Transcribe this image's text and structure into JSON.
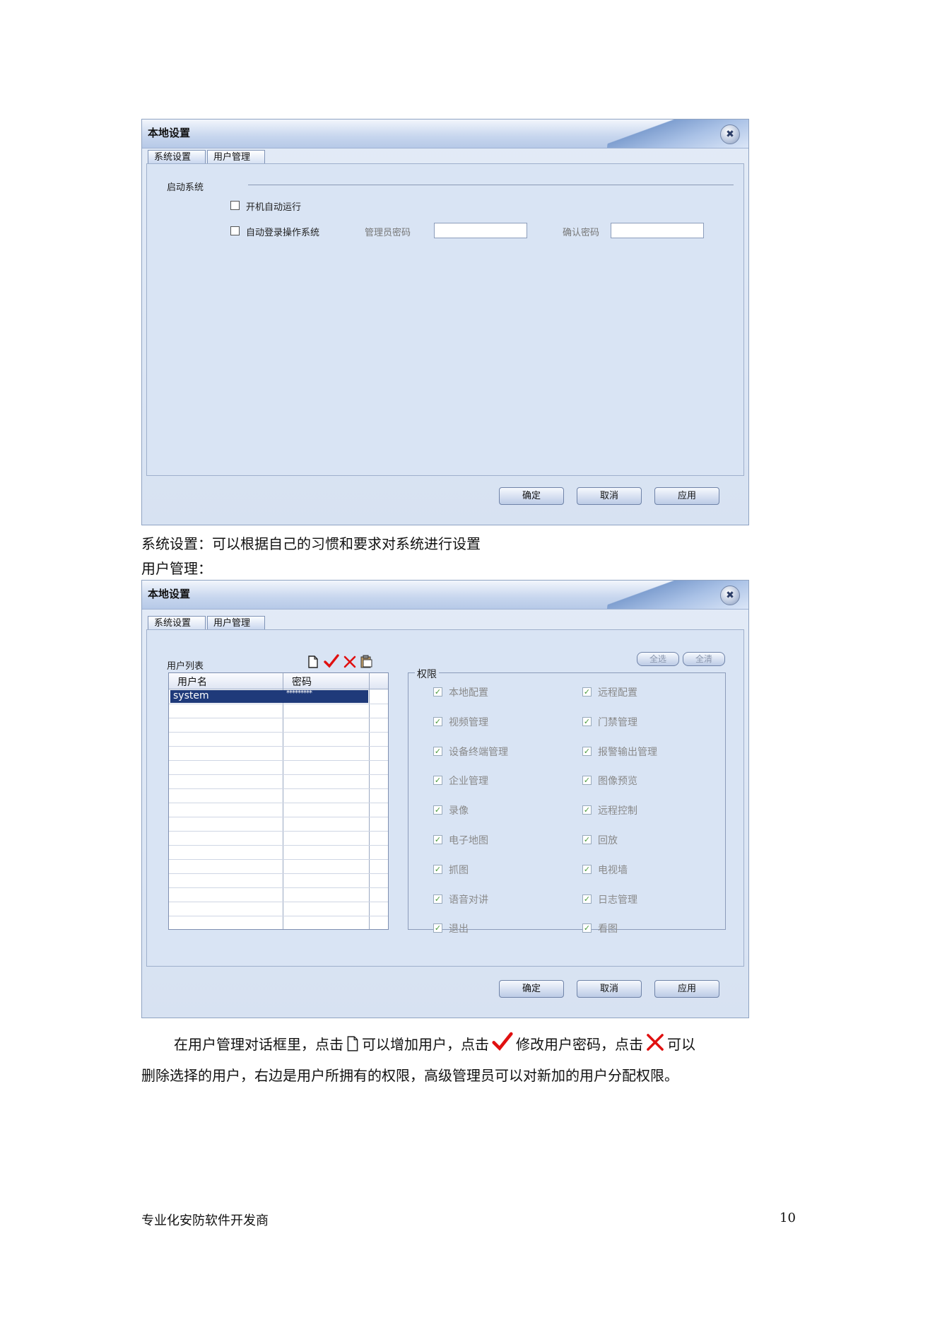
{
  "dialog1": {
    "title": "本地设置",
    "close_glyph": "✖",
    "tabs": [
      "系统设置",
      "用户管理"
    ],
    "section_label": "启动系统",
    "option_autorun": "开机自动运行",
    "option_autologin": "自动登录操作系统",
    "admin_password_label": "管理员密码",
    "confirm_password_label": "确认密码",
    "buttons": {
      "ok": "确定",
      "cancel": "取消",
      "apply": "应用"
    }
  },
  "caption_system": "系统设置：可以根据自己的习惯和要求对系统进行设置",
  "caption_user": "用户管理：",
  "dialog2": {
    "title": "本地设置",
    "close_glyph": "✖",
    "tabs": [
      "系统设置",
      "用户管理"
    ],
    "user_list_label": "用户列表",
    "columns": [
      "用户名",
      "密码"
    ],
    "rows": [
      {
        "name": "system",
        "password": "*********"
      }
    ],
    "toolbar_icons": [
      "new-document-icon",
      "checkmark-icon",
      "delete-x-icon",
      "clipboard-icon"
    ],
    "select_all": "全选",
    "clear_all": "全清",
    "permissions_label": "权限",
    "permissions_left": [
      "本地配置",
      "视频管理",
      "设备终端管理",
      "企业管理",
      "录像",
      "电子地图",
      "抓图",
      "语音对讲",
      "退出"
    ],
    "permissions_right": [
      "远程配置",
      "门禁管理",
      "报警输出管理",
      "图像预览",
      "远程控制",
      "回放",
      "电视墙",
      "日志管理",
      "看图"
    ],
    "buttons": {
      "ok": "确定",
      "cancel": "取消",
      "apply": "应用"
    }
  },
  "instruction": {
    "part1": "在用户管理对话框里，点击",
    "part2": "可以增加用户，点击",
    "part3": "修改用户密码，点击",
    "part4": "可以",
    "line2": "删除选择的用户，右边是用户所拥有的权限，高级管理员可以对新加的用户分配权限。"
  },
  "footer": {
    "company": "专业化安防软件开发商",
    "page_number": "10"
  },
  "colors": {
    "selection": "#1f3a7a",
    "check_red": "#e01010",
    "permission_check": "#4a9a3a"
  }
}
